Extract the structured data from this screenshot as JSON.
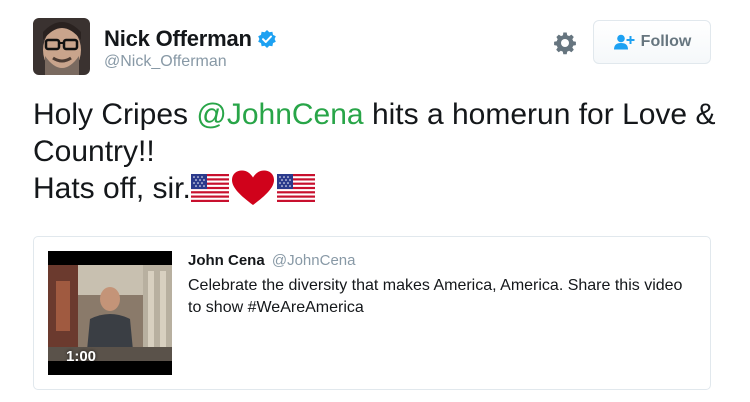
{
  "user": {
    "display_name": "Nick Offerman",
    "handle": "@Nick_Offerman",
    "verified": true
  },
  "actions": {
    "settings_icon": "gear-icon",
    "follow_label": "Follow"
  },
  "tweet": {
    "text_before_mention": "Holy Cripes ",
    "mention": "@JohnCena",
    "text_after_mention": " hits a homerun for Love & Country!!",
    "line2_text": "Hats off, sir.",
    "emoji": [
      "us-flag-icon",
      "red-heart-icon",
      "us-flag-icon"
    ]
  },
  "quoted_card": {
    "author_name": "John Cena",
    "author_handle": "@JohnCena",
    "text": "Celebrate the diversity that makes America, America. Share this video to show #WeAreAmerica",
    "video_duration": "1:00"
  },
  "colors": {
    "mention_green": "#28a548",
    "verified_blue": "#1da1f2",
    "heart_red": "#d0021b"
  }
}
